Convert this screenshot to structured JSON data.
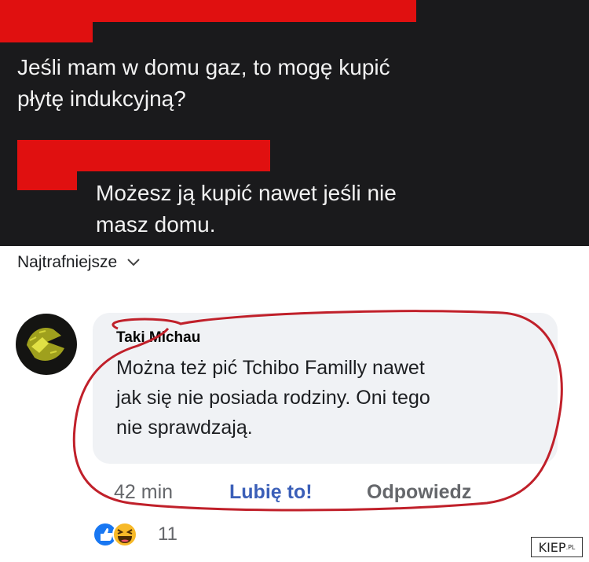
{
  "post": {
    "question": [
      "Jeśli mam w domu gaz, to mogę kupić",
      "płytę indukcyjną?"
    ],
    "answer": [
      "Możesz ją kupić nawet jeśli nie",
      "masz domu."
    ]
  },
  "sort": {
    "label": "Najtrafniejsze"
  },
  "comment": {
    "author": "Taki Michau",
    "text": [
      "Można też pić Tchibo Familly nawet",
      "jak się nie posiada rodziny. Oni tego",
      "nie sprawdzają."
    ],
    "time": "42 min",
    "like_label": "Lubię to!",
    "reply_label": "Odpowiedz",
    "reactions_count": "11"
  },
  "watermark": {
    "main": "KIEP",
    "suffix": ".PL"
  },
  "colors": {
    "redaction": "#e01010",
    "dark_bg": "#1a1a1c",
    "link": "#3b5fb8",
    "annotation": "#c0202a"
  }
}
